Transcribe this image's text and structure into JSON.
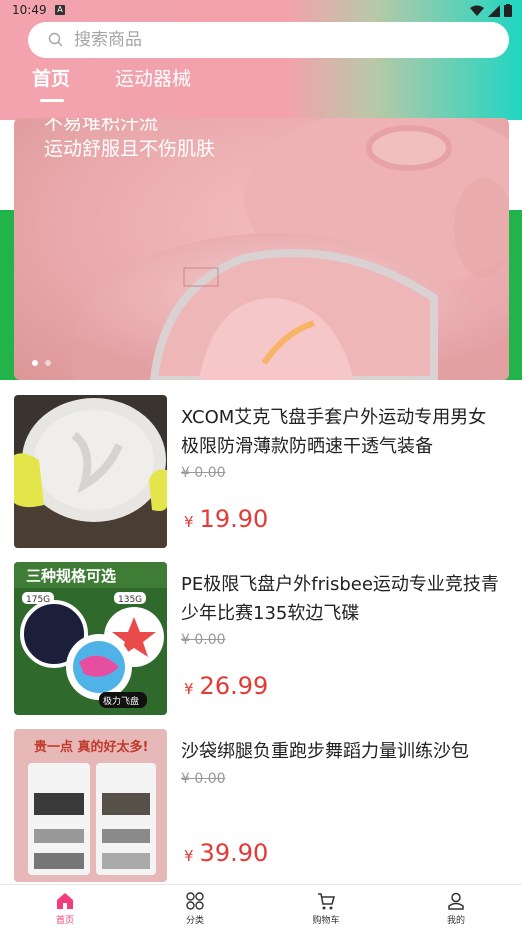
{
  "status": {
    "time": "10:49",
    "app_badge": "A"
  },
  "search": {
    "placeholder": "搜索商品"
  },
  "tabs": [
    {
      "label": "首页"
    },
    {
      "label": "运动器械"
    }
  ],
  "banner": {
    "line1": "不易堆积汗流",
    "line2": "运动舒服且不伤肌肤"
  },
  "products": [
    {
      "title": "XCOM艾克飞盘手套户外运动专用男女极限防滑薄款防晒速干透气装备",
      "old_price": "¥ 0.00",
      "currency": "¥",
      "price": "19.90"
    },
    {
      "title": "PE极限飞盘户外frisbee运动专业竞技青少年比赛135软边飞碟",
      "old_price": "¥ 0.00",
      "currency": "¥",
      "price": "26.99",
      "image_texts": {
        "headline": "三种规格可选",
        "size_a": "175G",
        "size_b": "135G",
        "brand": "极力飞盘"
      }
    },
    {
      "title": "沙袋绑腿负重跑步舞蹈力量训练沙包",
      "old_price": "¥ 0.00",
      "currency": "¥",
      "price": "39.90",
      "image_texts": {
        "headline": "贵一点 真的好太多!"
      }
    }
  ],
  "bottom_nav": [
    {
      "label": "首页"
    },
    {
      "label": "分类"
    },
    {
      "label": "购物车"
    },
    {
      "label": "我的"
    }
  ],
  "colors": {
    "accent": "#f53b7a",
    "price": "#e53935",
    "header_pink": "#f2a3ad",
    "header_teal": "#1fd6c2"
  }
}
